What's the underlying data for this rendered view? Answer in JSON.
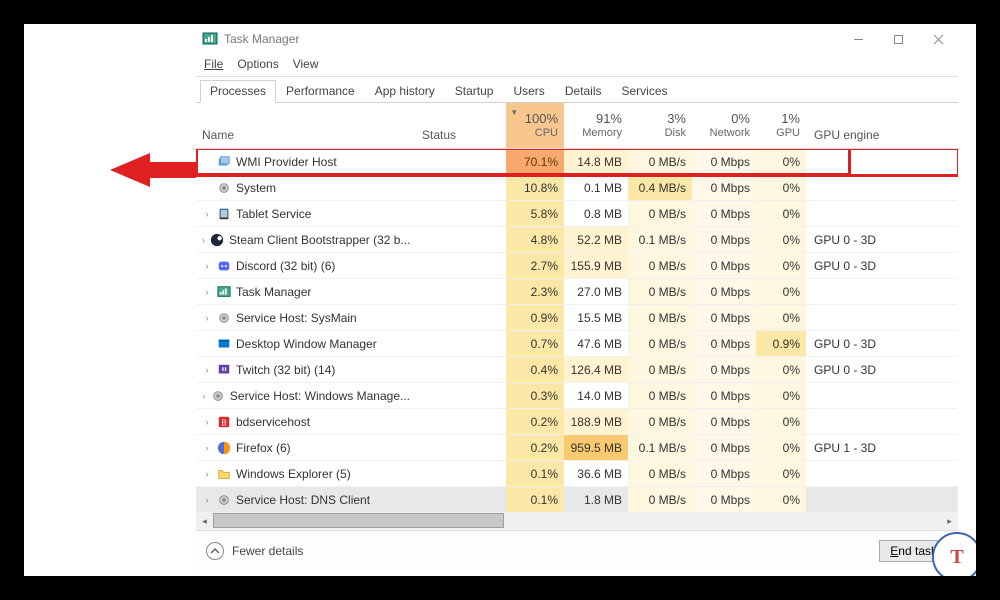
{
  "window": {
    "title": "Task Manager",
    "menus": [
      "File",
      "Options",
      "View"
    ],
    "tabs": [
      "Processes",
      "Performance",
      "App history",
      "Startup",
      "Users",
      "Details",
      "Services"
    ],
    "active_tab": 0
  },
  "columns": {
    "name": "Name",
    "status": "Status",
    "cpu": {
      "usage": "100%",
      "label": "CPU"
    },
    "mem": {
      "usage": "91%",
      "label": "Memory"
    },
    "disk": {
      "usage": "3%",
      "label": "Disk"
    },
    "net": {
      "usage": "0%",
      "label": "Network"
    },
    "gpu": {
      "usage": "1%",
      "label": "GPU"
    },
    "gpue": "GPU engine"
  },
  "processes": [
    {
      "expand": false,
      "icon": "wmi",
      "name": "WMI Provider Host",
      "cpu": "70.1%",
      "mem": "14.8 MB",
      "disk": "0 MB/s",
      "net": "0 Mbps",
      "gpu": "0%",
      "gpue": "",
      "highlight": true,
      "cpu_heat": "heat-cpu-high",
      "mem_heat": "heat-mem",
      "disk_heat": "heat-disk",
      "net_heat": "heat-net",
      "gpu_heat": "heat-gpu"
    },
    {
      "expand": false,
      "icon": "gear",
      "name": "System",
      "cpu": "10.8%",
      "mem": "0.1 MB",
      "disk": "0.4 MB/s",
      "net": "0 Mbps",
      "gpu": "0%",
      "gpue": "",
      "cpu_heat": "heat-cpu",
      "disk_heat": "heat-disk-med"
    },
    {
      "expand": true,
      "icon": "tablet",
      "name": "Tablet Service",
      "cpu": "5.8%",
      "mem": "0.8 MB",
      "disk": "0 MB/s",
      "net": "0 Mbps",
      "gpu": "0%",
      "gpue": "",
      "cpu_heat": "heat-cpu"
    },
    {
      "expand": true,
      "icon": "steam",
      "name": "Steam Client Bootstrapper (32 b...",
      "cpu": "4.8%",
      "mem": "52.2 MB",
      "disk": "0.1 MB/s",
      "net": "0 Mbps",
      "gpu": "0%",
      "gpue": "GPU 0 - 3D",
      "cpu_heat": "heat-cpu",
      "mem_heat": "heat-mem"
    },
    {
      "expand": true,
      "icon": "discord",
      "name": "Discord (32 bit) (6)",
      "cpu": "2.7%",
      "mem": "155.9 MB",
      "disk": "0 MB/s",
      "net": "0 Mbps",
      "gpu": "0%",
      "gpue": "GPU 0 - 3D",
      "cpu_heat": "heat-cpu",
      "mem_heat": "heat-mem"
    },
    {
      "expand": true,
      "icon": "tm",
      "name": "Task Manager",
      "cpu": "2.3%",
      "mem": "27.0 MB",
      "disk": "0 MB/s",
      "net": "0 Mbps",
      "gpu": "0%",
      "gpue": "",
      "cpu_heat": "heat-cpu"
    },
    {
      "expand": true,
      "icon": "gear",
      "name": "Service Host: SysMain",
      "cpu": "0.9%",
      "mem": "15.5 MB",
      "disk": "0 MB/s",
      "net": "0 Mbps",
      "gpu": "0%",
      "gpue": "",
      "cpu_heat": "heat-cpu"
    },
    {
      "expand": false,
      "icon": "dwm",
      "name": "Desktop Window Manager",
      "cpu": "0.7%",
      "mem": "47.6 MB",
      "disk": "0 MB/s",
      "net": "0 Mbps",
      "gpu": "0.9%",
      "gpue": "GPU 0 - 3D",
      "cpu_heat": "heat-cpu",
      "gpu_heat": "heat-gpu-med"
    },
    {
      "expand": true,
      "icon": "twitch",
      "name": "Twitch (32 bit) (14)",
      "cpu": "0.4%",
      "mem": "126.4 MB",
      "disk": "0 MB/s",
      "net": "0 Mbps",
      "gpu": "0%",
      "gpue": "GPU 0 - 3D",
      "cpu_heat": "heat-cpu",
      "mem_heat": "heat-mem"
    },
    {
      "expand": true,
      "icon": "gear",
      "name": "Service Host: Windows Manage...",
      "cpu": "0.3%",
      "mem": "14.0 MB",
      "disk": "0 MB/s",
      "net": "0 Mbps",
      "gpu": "0%",
      "gpue": "",
      "cpu_heat": "heat-cpu"
    },
    {
      "expand": true,
      "icon": "bd",
      "name": "bdservicehost",
      "cpu": "0.2%",
      "mem": "188.9 MB",
      "disk": "0 MB/s",
      "net": "0 Mbps",
      "gpu": "0%",
      "gpue": "",
      "cpu_heat": "heat-cpu",
      "mem_heat": "heat-mem"
    },
    {
      "expand": true,
      "icon": "firefox",
      "name": "Firefox (6)",
      "cpu": "0.2%",
      "mem": "959.5 MB",
      "disk": "0.1 MB/s",
      "net": "0 Mbps",
      "gpu": "0%",
      "gpue": "GPU 1 - 3D",
      "cpu_heat": "heat-cpu",
      "mem_heat": "heat-mem-high"
    },
    {
      "expand": true,
      "icon": "folder",
      "name": "Windows Explorer (5)",
      "cpu": "0.1%",
      "mem": "36.6 MB",
      "disk": "0 MB/s",
      "net": "0 Mbps",
      "gpu": "0%",
      "gpue": "",
      "cpu_heat": "heat-cpu"
    },
    {
      "expand": true,
      "icon": "gear",
      "name": "Service Host: DNS Client",
      "cpu": "0.1%",
      "mem": "1.8 MB",
      "disk": "0 MB/s",
      "net": "0 Mbps",
      "gpu": "0%",
      "gpue": "",
      "cpu_heat": "heat-cpu",
      "selected": true
    }
  ],
  "footer": {
    "fewer_details": "Fewer details",
    "end_task": "End task"
  }
}
